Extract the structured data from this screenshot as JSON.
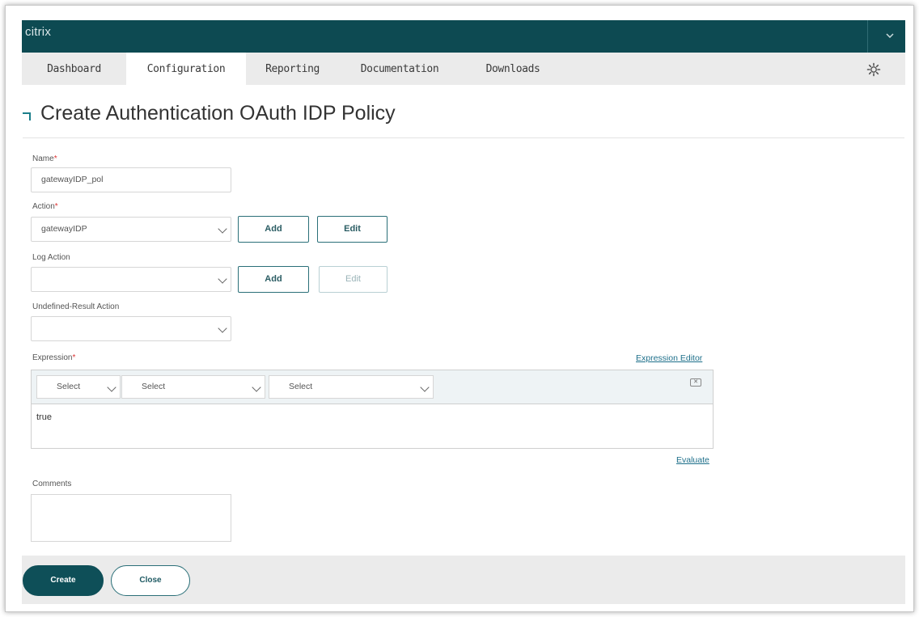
{
  "app": {
    "brand": "citrix"
  },
  "nav": {
    "tabs": [
      {
        "label": "Dashboard"
      },
      {
        "label": "Configuration"
      },
      {
        "label": "Reporting"
      },
      {
        "label": "Documentation"
      },
      {
        "label": "Downloads"
      }
    ],
    "active": "Configuration"
  },
  "page": {
    "title": "Create Authentication OAuth IDP Policy"
  },
  "form": {
    "name": {
      "label": "Name",
      "value": "gatewayIDP_pol"
    },
    "action": {
      "label": "Action",
      "value": "gatewayIDP",
      "add_label": "Add",
      "edit_label": "Edit"
    },
    "log_action": {
      "label": "Log Action",
      "value": "",
      "add_label": "Add",
      "edit_label": "Edit"
    },
    "undefined_action": {
      "label": "Undefined-Result Action",
      "value": ""
    },
    "expression": {
      "label": "Expression",
      "editor_link": "Expression Editor",
      "selects": [
        "Select",
        "Select",
        "Select"
      ],
      "value": "true",
      "evaluate_link": "Evaluate"
    },
    "comments": {
      "label": "Comments",
      "value": ""
    }
  },
  "footer": {
    "create_label": "Create",
    "close_label": "Close"
  },
  "colors": {
    "topbar": "#0d4a52",
    "accent": "#1b7e8a",
    "primary_button": "#0e4f58"
  },
  "required_marker": "*"
}
